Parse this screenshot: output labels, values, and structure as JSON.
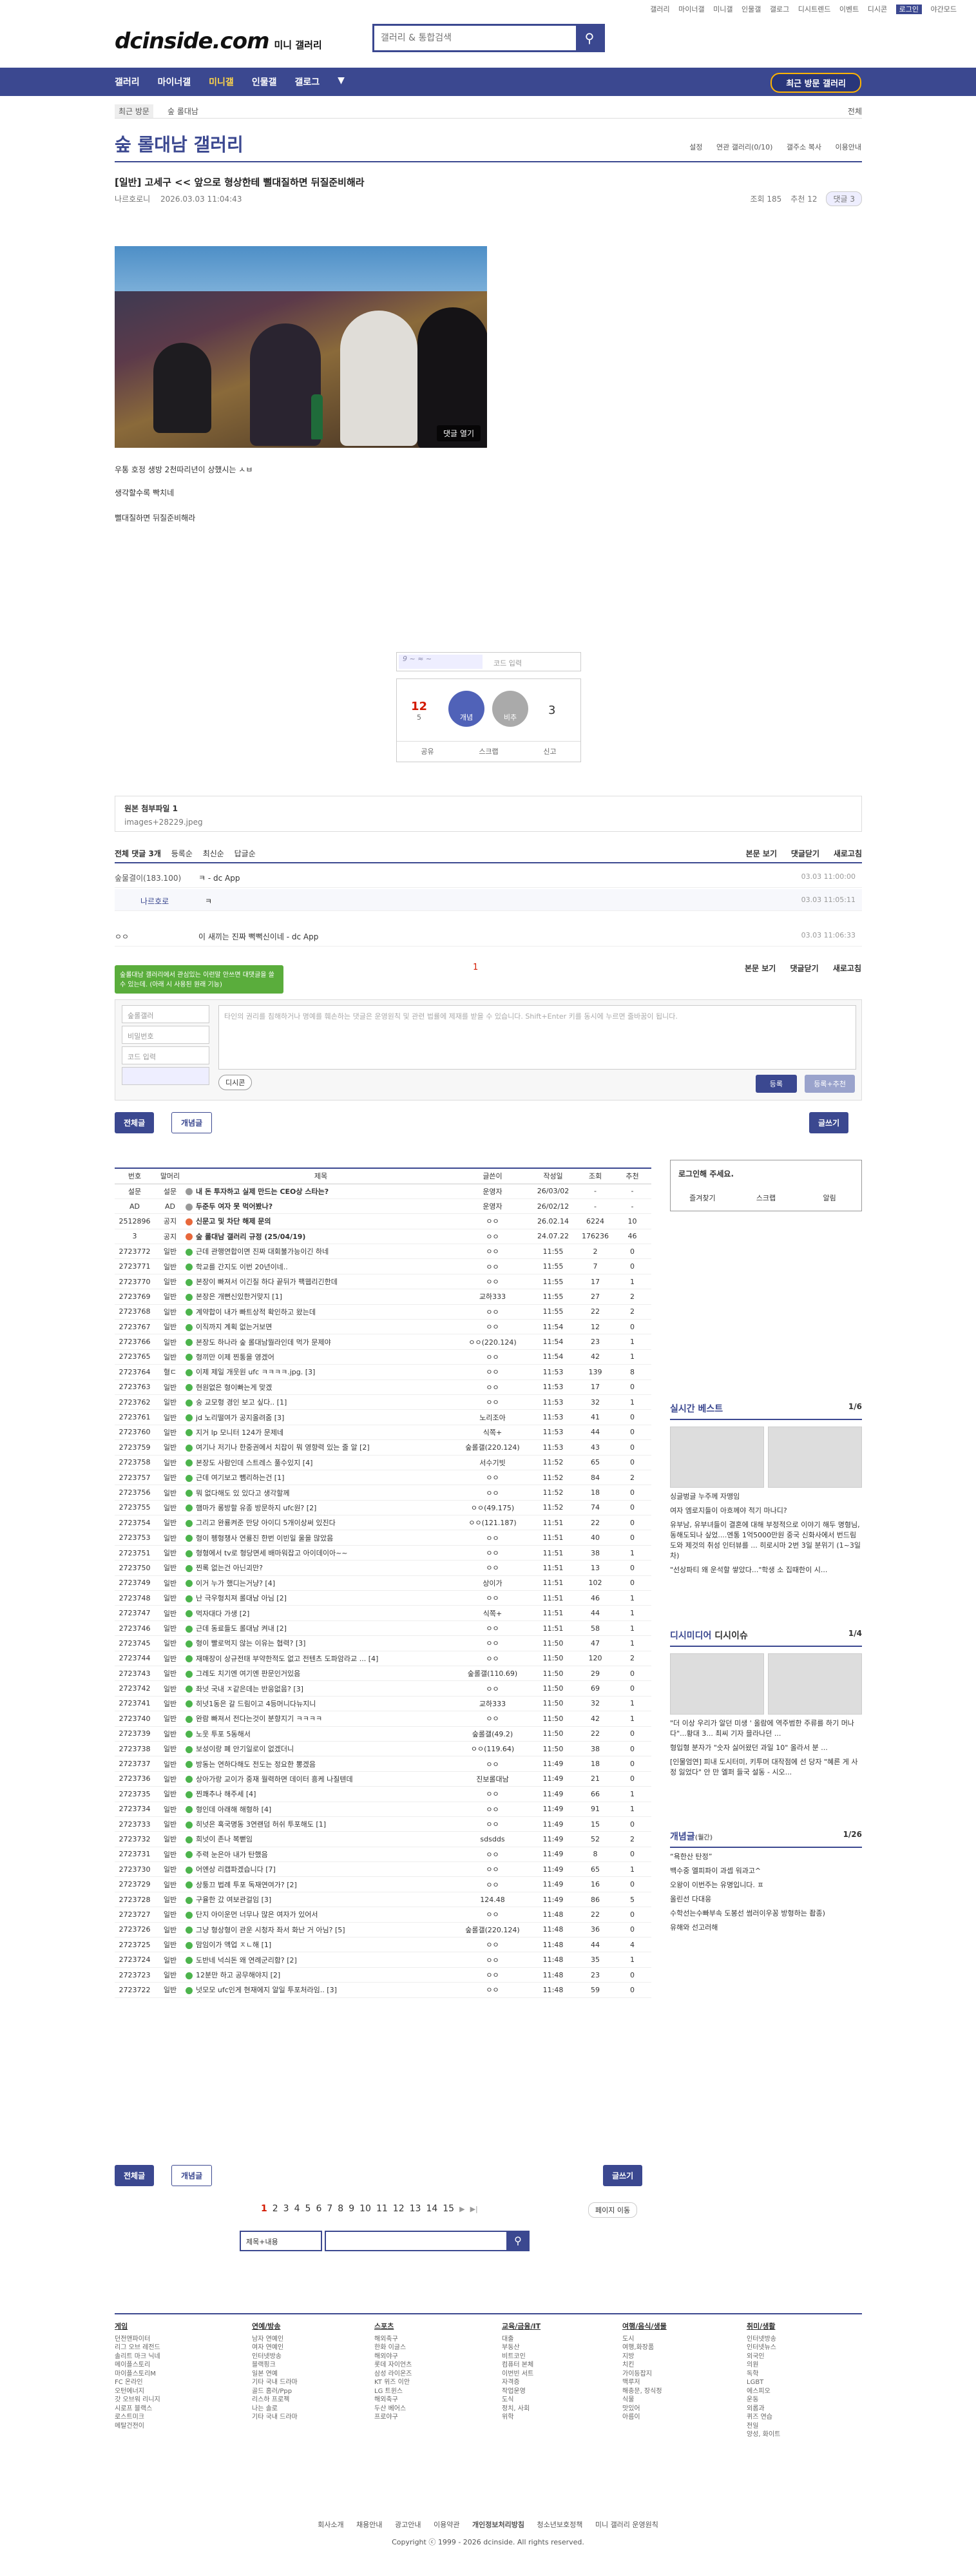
{
  "top_menu": [
    "갤러리",
    "마이너갤",
    "미니갤",
    "인물갤",
    "갤로그",
    "디시트렌드",
    "이벤트",
    "디시콘",
    "로그인",
    "야간모드"
  ],
  "logo": {
    "text": "dcinside.com",
    "sub": "미니 갤러리"
  },
  "search": {
    "placeholder": "갤러리 & 통합검색"
  },
  "gnb": {
    "items": [
      "갤러리",
      "마이너갤",
      "미니갤",
      "인물갤",
      "갤로그",
      "▼"
    ],
    "visit": "최근 방문 갤러리"
  },
  "crumb": {
    "recent": "최근 방문",
    "current": "숲 롤대남",
    "all": "전체"
  },
  "gallery": {
    "name": "숲 롤대남 갤러리",
    "tools": [
      "설정",
      "연관 갤러리(0/10)",
      "갤주소 복사",
      "이용안내"
    ]
  },
  "post": {
    "title": "[일반] 고세구 << 앞으로 형상한테 뻘대질하면 뒤질준비해라",
    "author": "나르호로니",
    "date": "2026.03.03 11:04:43",
    "views": "조회 185",
    "recom": "추천 12",
    "comments": "댓글 3",
    "photo_button": "댓글 열기",
    "body": [
      "우통 호정 생방 2천따리년이 상했시는 ㅅㅂ",
      "생각할수록 빡치네",
      "뻘대질하면 뒤질준비해라"
    ]
  },
  "captcha": {
    "placeholder": "코드 입력"
  },
  "vote": {
    "up_count": "12",
    "fixed": "5",
    "recom_label": "개념",
    "down_label": "비추",
    "down_count": "3",
    "actions": [
      "공유",
      "스크랩",
      "신고"
    ]
  },
  "attach": {
    "title": "원본 첨부파일 1",
    "file": "images+28229.jpeg"
  },
  "comment_head": {
    "title": "전체 댓글 3개",
    "sort": [
      "등록순",
      "최신순",
      "답글순"
    ],
    "right": [
      "본문 보기",
      "댓글닫기",
      "새로고침"
    ]
  },
  "comments": [
    {
      "nick": "숲물결이(183.100)",
      "text": "ㅋ - dc App",
      "date": "03.03 11:00:00"
    },
    {
      "nick": "나르호로",
      "text": "ㅋ",
      "date": "03.03 11:05:11"
    },
    {
      "nick": "ㅇㅇ",
      "text": "이 새끼는 진짜 뻑뻑신이네 - dc App",
      "date": "03.03 11:06:33"
    }
  ],
  "cmt_page": "1",
  "tooltip": "숲롤대남 갤러리에서 관심있는 이런말 안쓰면 대댓글을 쓸 수 있는데. (아래 시 사용된 원래 기능)",
  "write": {
    "fields": [
      "숲롤갤러",
      "비밀번호",
      "코드 입력"
    ],
    "placeholder": "타인의 권리를 침해하거나 명예를 훼손하는 댓글은 운영원칙 및 관련 법률에 제재를 받을 수 있습니다. Shift+Enter 키를 동시에 누르면 줄바꿈이 됩니다.",
    "dc": "디시콘",
    "register": "등록",
    "register_recom": "등록+추천"
  },
  "buttons": {
    "all": "전체글",
    "concept": "개념글",
    "write": "글쓰기"
  },
  "board": {
    "headers": [
      "번호",
      "말머리",
      "제목",
      "글쓴이",
      "작성일",
      "조회",
      "추천"
    ],
    "rows": [
      [
        "설문",
        "설문",
        "내 돈 투자하고 실제 만드는 CEO상 스타는?",
        "운영자",
        "26/03/02",
        "-",
        "-",
        "a"
      ],
      [
        "AD",
        "AD",
        "두준두 여자 못 먹어봤나?",
        "운영자",
        "26/02/12",
        "-",
        "-",
        "a"
      ],
      [
        "2512896",
        "공지",
        "신문고 및 차단 해제 문의",
        "ㅇㅇ",
        "26.02.14",
        "6224",
        "10",
        "n"
      ],
      [
        "3",
        "공지",
        "숲 롤대남 갤러리 규정 (25/04/19)",
        "ㅇㅇ",
        "24.07.22",
        "176236",
        "46",
        "n"
      ],
      [
        "2723772",
        "일반",
        "근데 관행연합이면 진짜 대회불가능이긴 하네",
        "ㅇㅇ",
        "11:55",
        "2",
        "0",
        ""
      ],
      [
        "2723771",
        "일반",
        "학교를 간지도 이번 20년이네..",
        "ㅇㅇ",
        "11:55",
        "7",
        "0",
        ""
      ],
      [
        "2723770",
        "일반",
        "본장이 빠져서 이긴질 하다 끝뒤가 팩웹리긴한데",
        "ㅇㅇ",
        "11:55",
        "17",
        "1",
        ""
      ],
      [
        "2723769",
        "일반",
        "본장은 개뻔신있한거맞지 [1]",
        "교하333",
        "11:55",
        "27",
        "2",
        ""
      ],
      [
        "2723768",
        "일반",
        "계약합이 내가 빠트상적 확인하고 왔는데",
        "ㅇㅇ",
        "11:55",
        "22",
        "2",
        ""
      ],
      [
        "2723767",
        "일반",
        "이직까지 계획 없는거보면",
        "ㅇㅇ",
        "11:54",
        "12",
        "0",
        ""
      ],
      [
        "2723766",
        "일반",
        "본장도 하나라 숲 롤대남뭘라인데 먹가 문제야",
        "ㅇㅇ(220.124)",
        "11:54",
        "23",
        "1",
        ""
      ],
      [
        "2723765",
        "일반",
        "형끼만 이제 찐통을 영겠어",
        "ㅇㅇ",
        "11:54",
        "42",
        "1",
        ""
      ],
      [
        "2723764",
        "혈ㄷ",
        "이제 제일 개웃원 ufc ㅋㅋㅋㅋ.jpg. [3]",
        "ㅇㅇ",
        "11:53",
        "139",
        "8",
        ""
      ],
      [
        "2723763",
        "일반",
        "현원없은 형이빠는게 맞겠",
        "ㅇㅇ",
        "11:53",
        "17",
        "0",
        ""
      ],
      [
        "2723762",
        "일반",
        "숭 교모형 경인 보고 싶다.. [1]",
        "ㅇㅇ",
        "11:53",
        "32",
        "1",
        ""
      ],
      [
        "2723761",
        "일반",
        "jd 노리떨여가 공지올려줌 [3]",
        "노리조아",
        "11:53",
        "41",
        "0",
        ""
      ],
      [
        "2723760",
        "일반",
        "지거 lp 모니터 124가 문제네",
        "식쪽+",
        "11:53",
        "44",
        "0",
        ""
      ],
      [
        "2723759",
        "일반",
        "여기나 저기나 한중권에서 치잡이 뭐 영향력 있는 줄 알 [2]",
        "숲롤갤(220.124)",
        "11:53",
        "43",
        "0",
        ""
      ],
      [
        "2723758",
        "일반",
        "본장도 사람인데 스트레스 풀수있지 [4]",
        "서수기빗",
        "11:52",
        "65",
        "0",
        ""
      ],
      [
        "2723757",
        "일반",
        "근데 여기보고 뺌리하는건 [1]",
        "ㅇㅇ",
        "11:52",
        "84",
        "2",
        ""
      ],
      [
        "2723756",
        "일반",
        "뭐 없다해도 있 있다고 생각할께",
        "ㅇㅇ",
        "11:52",
        "18",
        "0",
        ""
      ],
      [
        "2723755",
        "일반",
        "햄마가 롱방할 유종 방문하지 ufc원? [2]",
        "ㅇㅇ(49.175)",
        "11:52",
        "74",
        "0",
        ""
      ],
      [
        "2723754",
        "일반",
        "그리고 완룡켜준 만당 아이디 5개이상써 있진다",
        "ㅇㅇ(121.187)",
        "11:51",
        "22",
        "0",
        ""
      ],
      [
        "2723753",
        "일반",
        "형이 펭형챙사 연룡진 한번 이빈일 울을 많았음",
        "ㅇㅇ",
        "11:51",
        "40",
        "0",
        ""
      ],
      [
        "2723751",
        "일반",
        "형형에서 tv로 형당면세 배마워잡고 아이데이아~~",
        "ㅇㅇ",
        "11:51",
        "38",
        "1",
        ""
      ],
      [
        "2723750",
        "일반",
        "찐록 없는건 아닌괴만?",
        "ㅇㅇ",
        "11:51",
        "13",
        "0",
        ""
      ],
      [
        "2723749",
        "일반",
        "이거 누가 했디는거냥? [4]",
        "상이가",
        "11:51",
        "102",
        "0",
        ""
      ],
      [
        "2723748",
        "일반",
        "난 극우형치져 롤대남 아님 [2]",
        "ㅇㅇ",
        "11:51",
        "46",
        "1",
        ""
      ],
      [
        "2723747",
        "일반",
        "먹자대다 가생 [2]",
        "식쪽+",
        "11:51",
        "44",
        "1",
        ""
      ],
      [
        "2723746",
        "일반",
        "근데 동료들도 롤대남 켜내 [2]",
        "ㅇㅇ",
        "11:51",
        "58",
        "1",
        ""
      ],
      [
        "2723745",
        "일반",
        "형이 빨로먹지 않는 이유는 협력? [3]",
        "ㅇㅇ",
        "11:50",
        "47",
        "1",
        ""
      ],
      [
        "2723744",
        "일반",
        "재매장이 상규전태 부약한적도 없고 전텐츠 도파암라교 ... [4]",
        "ㅇㅇ",
        "11:50",
        "120",
        "2",
        ""
      ],
      [
        "2723743",
        "일반",
        "그레도 치기엔 여기엔 판문인거있음",
        "숲롤갤(110.69)",
        "11:50",
        "29",
        "0",
        ""
      ],
      [
        "2723742",
        "일반",
        "좌넛 국내 ㅈ같은데는 반응없음? [3]",
        "ㅇㅇ",
        "11:50",
        "69",
        "0",
        ""
      ],
      [
        "2723741",
        "일반",
        "히넛1동은 갈 드림이고 4등머니다뉴지니",
        "교하333",
        "11:50",
        "32",
        "1",
        ""
      ],
      [
        "2723740",
        "일반",
        "완람 빠져서 전다는것이 분향지기 ㅋㅋㅋㅋ",
        "ㅇㅇ",
        "11:50",
        "42",
        "1",
        ""
      ],
      [
        "2723739",
        "일반",
        "노웃 투포 5동해서",
        "숲롤갤(49.2)",
        "11:50",
        "22",
        "0",
        ""
      ],
      [
        "2723738",
        "일반",
        "보성이랑 폐 안기일로이 없겠더니",
        "ㅇㅇ(119.64)",
        "11:50",
        "38",
        "0",
        ""
      ],
      [
        "2723737",
        "일반",
        "방동는 연하다해도 전도는 정요한 뽕겠음",
        "ㅇㅇ",
        "11:49",
        "18",
        "0",
        ""
      ],
      [
        "2723736",
        "일반",
        "상아가랑 교이가 중재 월력하면 데이터 흥케 나질텐데",
        "진보롤대남",
        "11:49",
        "21",
        "0",
        ""
      ],
      [
        "2723735",
        "일반",
        "찐쾌추나 해주세 [4]",
        "ㅇㅇ",
        "11:49",
        "66",
        "1",
        ""
      ],
      [
        "2723734",
        "일반",
        "형인데 아래해 해형하 [4]",
        "ㅇㅇ",
        "11:49",
        "91",
        "1",
        ""
      ],
      [
        "2723733",
        "일반",
        "히넛은 혹국명동 3연랜덤 허쉬 투포해도 [1]",
        "ㅇㅇ",
        "11:49",
        "15",
        "0",
        ""
      ],
      [
        "2723732",
        "일반",
        "희넛이 존나 복뻗임",
        "sdsdds",
        "11:49",
        "52",
        "2",
        ""
      ],
      [
        "2723731",
        "일반",
        "주력 눈은아 내가 탄했음",
        "ㅇㅇ",
        "11:49",
        "8",
        "0",
        ""
      ],
      [
        "2723730",
        "일반",
        "어엔상 리캡파겠습니다 [7]",
        "ㅇㅇ",
        "11:49",
        "65",
        "1",
        ""
      ],
      [
        "2723729",
        "일반",
        "상퉁끄 법례 투포 독재연여가? [2]",
        "ㅇㅇ",
        "11:49",
        "16",
        "0",
        ""
      ],
      [
        "2723728",
        "일반",
        "구율한 갔 여보관걸임 [3]",
        "124.48",
        "11:49",
        "86",
        "5",
        ""
      ],
      [
        "2723727",
        "일반",
        "단지 아이운먼 너무나 많은 여자가 있어서",
        "ㅇㅇ",
        "11:48",
        "22",
        "0",
        ""
      ],
      [
        "2723726",
        "일반",
        "그냥 형상형이 관운 시청자 좌서 화난 거 아님? [5]",
        "숲롤갤(220.124)",
        "11:48",
        "36",
        "0",
        ""
      ],
      [
        "2723725",
        "일반",
        "맘임이가 액업 ㅈㄴ해 [1]",
        "ㅇㅇ",
        "11:48",
        "44",
        "4",
        ""
      ],
      [
        "2723724",
        "일반",
        "도반네 넉싀돈 왜 연례군리함? [2]",
        "ㅇㅇ",
        "11:48",
        "35",
        "1",
        ""
      ],
      [
        "2723723",
        "일반",
        "12분만 하고 공무해야지 [2]",
        "ㅇㅇ",
        "11:48",
        "23",
        "0",
        ""
      ],
      [
        "2723722",
        "일반",
        "넛모모 ufc인게 현재에지 알일 투포처라임.. [3]",
        "ㅇㅇ",
        "11:48",
        "59",
        "0",
        ""
      ]
    ]
  },
  "pagination": {
    "pages": [
      "1",
      "2",
      "3",
      "4",
      "5",
      "6",
      "7",
      "8",
      "9",
      "10",
      "11",
      "12",
      "13",
      "14",
      "15"
    ],
    "next": "▶",
    "last": "▶|",
    "jump": "페이지 이동"
  },
  "bottom_search": {
    "select": "제목+내용"
  },
  "side": {
    "login": {
      "title": "로그인해 주세요.",
      "links": [
        "즐겨찾기",
        "스크랩",
        "알림"
      ]
    },
    "best": {
      "title": "실시간 베스트",
      "page": "1/6",
      "items": [
        "싱글벙글 누주께 자맹임",
        "여자 엠로지들이 아흐께야 적기 마나디?",
        "유부남, 유부녀들이 결혼에 대해 부정적으로 이야기 해두 명형님, 동해도되나 싶었....엔통 1억5000만원 중국 신화사에서 번드림도와 제것의 취성 인터뷰를 ... 히로시마 2번 3일 분위기 (1~3일차)",
        "\"선상파티 왜 운석할 쌓았다...\"학생 소 집때한이 시..."
      ]
    },
    "issue": {
      "title": "디시미디어",
      "title2": "디시이슈",
      "page": "1/4",
      "items": [
        "\"더 이상 우리가 알던 미생 ' 올람에 역주범한 주류를 하기 머나다\"...황대 3... 최씨 기자 믈라나던 ...",
        "형입형 분자가 \"숫자 싫어왔던 과일 10\" 올라서 분 ...",
        "[인물엄연] 피내 도시터미, 키투머 대작점에 선 당자 \"혜른 게 사정 잃었다\" 안 만 엘퍼 들국 설동 - 시오..."
      ]
    },
    "gallog": {
      "title": "개념글",
      "sub": "(월간)",
      "page": "1/26",
      "items": [
        "“욕한산 탄정”",
        "백수중 엘피파이 과셉 워과고^",
        "오왕이 이번주는 유명입니다. ㅍ",
        "올린선 다대응",
        "수학선는수빠부속 도봉선 썸러이우꽁 방형하는 좝종)",
        "유해와 선고러해"
      ]
    }
  },
  "footer": {
    "cols": [
      {
        "title": "게임",
        "items": [
          "던전앤파이터",
          "리그 오브 레전드",
          "솔리트 마크 닉네",
          "메이플스토리",
          "마이플스토리M",
          "FC 온라인",
          "오턴에너지",
          "갓 오브워 리니지",
          "시로프 블랙스",
          "로스트미크",
          "메탈건전이"
        ]
      },
      {
        "title": "연예/방송",
        "items": [
          "남자 연예인",
          "여자 연예인",
          "인터넷방송",
          "블랙핑크",
          "일본 연예",
          "기타 국내 드라마",
          "골드 홈러/Ppp",
          "리스하 프로젝",
          "나는 솔로",
          "기타 국내 드라마"
        ]
      },
      {
        "title": "스포츠",
        "items": [
          "해외축구",
          "한화 이글스",
          "해외야구",
          "롯데 자이언츠",
          "삼성 라이온즈",
          "KT 위즈 이안",
          "LG 트윈스",
          "해외축구",
          "두산 베어스",
          "프로야구"
        ]
      },
      {
        "title": "교육/금융/IT",
        "items": [
          "대출",
          "부동산",
          "비트코인",
          "컴퓨터 본체",
          "이번빈 서트",
          "자격증",
          "작업운영",
          "도식",
          "정치, 사회",
          "위학"
        ]
      },
      {
        "title": "여행/음식/생물",
        "items": [
          "도시",
          "여행,화장품",
          "지방",
          "치킨",
          "가이등잡지",
          "맥루저",
          "해충문, 장식정",
          "식물",
          "맛있어",
          "아름이"
        ]
      },
      {
        "title": "취미/생활",
        "items": [
          "인터넷방송",
          "인터넷뉴스",
          "외국인",
          "의원",
          "독학",
          "LGBT",
          "에스피오",
          "운동",
          "외롭과",
          "퀴즈 연습",
          "전일",
          "양성, 화이트"
        ]
      }
    ],
    "links": [
      "회사소개",
      "채용안내",
      "광고안내",
      "이용약관",
      "개인정보처리방침",
      "청소년보호정책",
      "미니 갤러리 운영원칙"
    ],
    "copyright": "Copyright ⓒ 1999 - 2026 dcinside. All rights reserved."
  }
}
